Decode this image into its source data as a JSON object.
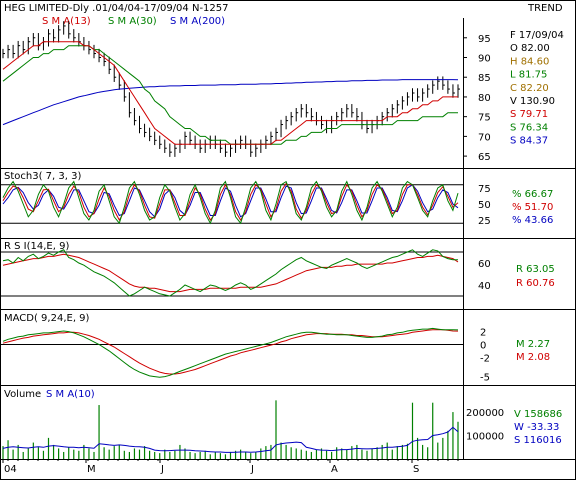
{
  "header": {
    "title": "HEG LIMITED-Dly .01/04/04-17/09/04  N-1257",
    "trend_label": "TREND"
  },
  "colors": {
    "price": "#000000",
    "sma13": "#d00000",
    "sma30": "#008000",
    "sma200": "#0000c0",
    "frame": "#000000"
  },
  "price_panel": {
    "legend": [
      {
        "text": "S M A(13)",
        "color": "#d00000"
      },
      {
        "text": "S M A(30)",
        "color": "#008000"
      },
      {
        "text": "S M A(200)",
        "color": "#0000c0"
      }
    ],
    "y_ticks": [
      "95",
      "90",
      "85",
      "80",
      "75",
      "70",
      "65"
    ],
    "info": [
      {
        "text": "F 17/09/04",
        "color": "#000000"
      },
      {
        "text": "O   82.00",
        "color": "#000000"
      },
      {
        "text": "H   84.60",
        "color": "#a07000"
      },
      {
        "text": "L   81.75",
        "color": "#008000"
      },
      {
        "text": "C   82.20",
        "color": "#a07000"
      },
      {
        "text": "V  130.90",
        "color": "#000000"
      },
      {
        "text": "S   79.71",
        "color": "#d00000"
      },
      {
        "text": "S   76.34",
        "color": "#008000"
      },
      {
        "text": "S   84.37",
        "color": "#0000c0"
      }
    ]
  },
  "stoch_panel": {
    "label": "Stoch3( 7, 3, 3)",
    "y_ticks": [
      "75",
      "50",
      "25"
    ],
    "values": [
      {
        "text": "%   66.67",
        "color": "#008000"
      },
      {
        "text": "%   51.70",
        "color": "#d00000"
      },
      {
        "text": "%   43.66",
        "color": "#0000c0"
      }
    ]
  },
  "rsi_panel": {
    "label": "R S I(14,E, 9)",
    "y_ticks": [
      "60",
      "40"
    ],
    "values": [
      {
        "text": "R   63.05",
        "color": "#008000"
      },
      {
        "text": "R   60.76",
        "color": "#d00000"
      }
    ]
  },
  "macd_panel": {
    "label": "MACD( 9,24,E, 9)",
    "y_ticks": [
      "2",
      "0",
      "-2",
      "-5"
    ],
    "values": [
      {
        "text": "M    2.27",
        "color": "#008000"
      },
      {
        "text": "M    2.08",
        "color": "#d00000"
      }
    ]
  },
  "volume_panel": {
    "label_prefix": "Volume",
    "label_sma": "S M A(10)",
    "y_ticks": [
      "200000",
      "100000"
    ],
    "values": [
      {
        "text": "V  158686",
        "color": "#008000"
      },
      {
        "text": "W   -33.33",
        "color": "#0000c0"
      },
      {
        "text": "S  116016",
        "color": "#0000c0"
      }
    ]
  },
  "x_axis": {
    "ticks": [
      "04",
      "M",
      "J",
      "J",
      "A",
      "S"
    ]
  },
  "chart_data": {
    "type": "line",
    "title": "HEG LIMITED-Dly .01/04/04-17/09/04  N-1257",
    "x_range": [
      "01/04/04",
      "17/09/04"
    ],
    "price": {
      "ylim": [
        63,
        99
      ],
      "close": [
        91,
        92,
        91,
        93,
        92,
        94,
        95,
        93,
        94,
        96,
        95,
        97,
        98,
        96,
        95,
        94,
        93,
        92,
        91,
        90,
        89,
        87,
        85,
        83,
        80,
        76,
        74,
        72,
        71,
        70,
        69,
        68,
        67,
        66,
        67,
        68,
        70,
        69,
        68,
        67,
        68,
        69,
        68,
        67,
        66,
        67,
        68,
        69,
        68,
        66,
        67,
        68,
        69,
        70,
        71,
        73,
        74,
        75,
        76,
        77,
        76,
        75,
        74,
        73,
        72,
        74,
        75,
        76,
        77,
        76,
        75,
        73,
        72,
        73,
        74,
        75,
        76,
        77,
        78,
        79,
        80,
        81,
        80,
        81,
        82,
        83,
        84,
        83,
        82,
        81,
        82
      ],
      "sma13": [
        87,
        88,
        89,
        90,
        91,
        92,
        93,
        93,
        94,
        94,
        94,
        94,
        94,
        94,
        94,
        94,
        93,
        93,
        92,
        91,
        90,
        89,
        88,
        86,
        84,
        82,
        80,
        78,
        76,
        74,
        72,
        71,
        70,
        69,
        68,
        68,
        68,
        68,
        68,
        68,
        68,
        68,
        68,
        68,
        68,
        68,
        68,
        68,
        68,
        68,
        68,
        68,
        68,
        68,
        69,
        69,
        70,
        71,
        72,
        73,
        74,
        74,
        74,
        74,
        74,
        74,
        74,
        74,
        74,
        74,
        74,
        74,
        74,
        74,
        74,
        74,
        75,
        75,
        75,
        76,
        76,
        77,
        77,
        78,
        78,
        79,
        79,
        80,
        80,
        80,
        80
      ],
      "sma30": [
        84,
        85,
        86,
        87,
        88,
        89,
        90,
        90,
        91,
        91,
        92,
        92,
        92,
        93,
        93,
        93,
        93,
        93,
        92,
        92,
        91,
        90,
        89,
        88,
        87,
        86,
        85,
        84,
        82,
        81,
        79,
        78,
        77,
        75,
        74,
        73,
        72,
        72,
        71,
        70,
        70,
        69,
        69,
        69,
        69,
        68,
        68,
        68,
        68,
        68,
        68,
        68,
        68,
        68,
        68,
        68,
        69,
        69,
        69,
        70,
        70,
        71,
        71,
        71,
        72,
        72,
        72,
        73,
        73,
        73,
        73,
        73,
        73,
        73,
        73,
        73,
        73,
        73,
        74,
        74,
        74,
        74,
        74,
        75,
        75,
        75,
        75,
        75,
        76,
        76,
        76
      ],
      "sma200": [
        73,
        73.5,
        74,
        74.5,
        75,
        75.5,
        76,
        76.5,
        77,
        77.5,
        78,
        78.4,
        78.8,
        79.2,
        79.6,
        80,
        80.3,
        80.6,
        80.9,
        81.2,
        81.4,
        81.6,
        81.8,
        82,
        82.1,
        82.2,
        82.3,
        82.4,
        82.5,
        82.6,
        82.6,
        82.7,
        82.7,
        82.8,
        82.8,
        82.8,
        82.9,
        82.9,
        82.9,
        83,
        83,
        83,
        83,
        83.1,
        83.1,
        83.1,
        83.1,
        83.2,
        83.2,
        83.2,
        83.2,
        83.3,
        83.3,
        83.3,
        83.4,
        83.4,
        83.5,
        83.5,
        83.6,
        83.6,
        83.7,
        83.7,
        83.8,
        83.8,
        83.9,
        83.9,
        84,
        84,
        84,
        84.1,
        84.1,
        84.1,
        84.2,
        84.2,
        84.2,
        84.3,
        84.3,
        84.3,
        84.3,
        84.4,
        84.4,
        84.4,
        84.4,
        84.4,
        84.4,
        84.4,
        84.4,
        84.4,
        84.4,
        84.4,
        84.37
      ],
      "last": {
        "open": 82.0,
        "high": 84.6,
        "low": 81.75,
        "close": 82.2
      }
    },
    "stoch": {
      "ylim": [
        0,
        100
      ],
      "levels": [
        80,
        20
      ],
      "k": [
        60,
        75,
        85,
        70,
        50,
        30,
        40,
        65,
        80,
        70,
        45,
        30,
        50,
        75,
        85,
        60,
        35,
        25,
        40,
        70,
        80,
        55,
        30,
        20,
        45,
        75,
        85,
        65,
        40,
        25,
        30,
        60,
        80,
        70,
        45,
        25,
        35,
        65,
        80,
        60,
        35,
        20,
        40,
        75,
        85,
        60,
        30,
        20,
        45,
        75,
        85,
        70,
        40,
        25,
        50,
        80,
        85,
        65,
        35,
        25,
        45,
        75,
        85,
        70,
        45,
        30,
        40,
        70,
        85,
        65,
        40,
        25,
        45,
        75,
        85,
        70,
        50,
        30,
        45,
        75,
        85,
        80,
        60,
        40,
        30,
        55,
        75,
        80,
        55,
        40,
        67
      ],
      "d": [
        55,
        68,
        78,
        75,
        60,
        42,
        38,
        55,
        72,
        73,
        55,
        38,
        45,
        65,
        78,
        68,
        45,
        30,
        35,
        58,
        75,
        62,
        40,
        25,
        38,
        65,
        80,
        70,
        48,
        30,
        28,
        50,
        72,
        72,
        52,
        32,
        32,
        55,
        75,
        65,
        42,
        25,
        35,
        65,
        80,
        65,
        38,
        25,
        38,
        65,
        80,
        73,
        50,
        30,
        42,
        70,
        82,
        70,
        42,
        28,
        40,
        65,
        80,
        73,
        52,
        35,
        38,
        62,
        80,
        70,
        48,
        30,
        40,
        65,
        80,
        73,
        55,
        35,
        40,
        65,
        80,
        80,
        65,
        45,
        33,
        48,
        68,
        77,
        62,
        45,
        52
      ],
      "s": [
        50,
        60,
        72,
        76,
        68,
        52,
        42,
        48,
        65,
        72,
        62,
        45,
        42,
        55,
        72,
        72,
        55,
        38,
        35,
        48,
        68,
        66,
        48,
        32,
        35,
        55,
        75,
        72,
        55,
        38,
        30,
        42,
        65,
        72,
        60,
        40,
        33,
        48,
        68,
        68,
        50,
        32,
        32,
        55,
        75,
        70,
        48,
        30,
        35,
        55,
        75,
        75,
        58,
        38,
        38,
        60,
        78,
        75,
        52,
        35,
        36,
        55,
        75,
        75,
        58,
        40,
        36,
        52,
        72,
        72,
        55,
        36,
        36,
        55,
        75,
        75,
        60,
        40,
        38,
        55,
        75,
        80,
        70,
        52,
        38,
        42,
        60,
        72,
        68,
        50,
        44
      ]
    },
    "rsi": {
      "ylim": [
        20,
        80
      ],
      "levels": [
        70,
        30
      ],
      "rsi": [
        62,
        63,
        60,
        65,
        62,
        66,
        68,
        64,
        66,
        69,
        67,
        70,
        72,
        65,
        63,
        60,
        58,
        55,
        52,
        50,
        48,
        45,
        42,
        38,
        34,
        30,
        32,
        35,
        38,
        36,
        34,
        32,
        31,
        30,
        33,
        36,
        40,
        38,
        36,
        34,
        37,
        40,
        39,
        37,
        35,
        37,
        40,
        42,
        40,
        36,
        38,
        41,
        44,
        47,
        50,
        54,
        57,
        60,
        63,
        65,
        62,
        60,
        58,
        56,
        55,
        58,
        60,
        62,
        64,
        62,
        60,
        57,
        55,
        57,
        59,
        61,
        63,
        65,
        66,
        68,
        70,
        72,
        68,
        66,
        69,
        72,
        71,
        66,
        64,
        63,
        63
      ],
      "signal": [
        58,
        59,
        60,
        61,
        62,
        63,
        64,
        64,
        65,
        66,
        66,
        67,
        68,
        67,
        66,
        65,
        63,
        61,
        59,
        57,
        55,
        53,
        50,
        47,
        44,
        41,
        39,
        38,
        38,
        37,
        37,
        36,
        35,
        34,
        34,
        34,
        35,
        36,
        36,
        36,
        36,
        37,
        37,
        37,
        37,
        37,
        37,
        38,
        38,
        38,
        38,
        38,
        39,
        40,
        41,
        43,
        45,
        47,
        49,
        51,
        53,
        54,
        55,
        56,
        56,
        56,
        57,
        57,
        58,
        58,
        59,
        59,
        59,
        59,
        59,
        59,
        60,
        60,
        61,
        62,
        63,
        64,
        65,
        65,
        66,
        66,
        67,
        66,
        65,
        64,
        61
      ]
    },
    "macd": {
      "ylim": [
        -6,
        3.5
      ],
      "macd": [
        0.5,
        0.8,
        1.0,
        1.2,
        1.3,
        1.5,
        1.6,
        1.7,
        1.8,
        1.8,
        1.9,
        2.0,
        2.1,
        2.0,
        1.8,
        1.5,
        1.2,
        0.8,
        0.4,
        0,
        -0.5,
        -1.0,
        -1.6,
        -2.2,
        -2.8,
        -3.4,
        -3.9,
        -4.3,
        -4.6,
        -4.9,
        -5.0,
        -5.1,
        -5.0,
        -4.8,
        -4.5,
        -4.2,
        -3.9,
        -3.6,
        -3.3,
        -3.0,
        -2.7,
        -2.4,
        -2.1,
        -1.8,
        -1.5,
        -1.3,
        -1.1,
        -0.9,
        -0.7,
        -0.5,
        -0.3,
        -0.1,
        0.1,
        0.3,
        0.6,
        0.9,
        1.2,
        1.4,
        1.6,
        1.8,
        1.9,
        1.9,
        1.8,
        1.7,
        1.6,
        1.6,
        1.5,
        1.5,
        1.5,
        1.4,
        1.3,
        1.2,
        1.1,
        1.1,
        1.2,
        1.3,
        1.5,
        1.6,
        1.8,
        1.9,
        2.1,
        2.2,
        2.3,
        2.4,
        2.4,
        2.5,
        2.4,
        2.3,
        2.3,
        2.3,
        2.27
      ],
      "signal": [
        0.2,
        0.4,
        0.6,
        0.8,
        1.0,
        1.1,
        1.3,
        1.4,
        1.5,
        1.6,
        1.7,
        1.8,
        1.8,
        1.9,
        1.9,
        1.8,
        1.6,
        1.4,
        1.1,
        0.8,
        0.4,
        0,
        -0.4,
        -0.9,
        -1.4,
        -1.9,
        -2.4,
        -2.9,
        -3.3,
        -3.7,
        -4.0,
        -4.3,
        -4.5,
        -4.6,
        -4.6,
        -4.5,
        -4.3,
        -4.1,
        -3.9,
        -3.6,
        -3.3,
        -3.0,
        -2.7,
        -2.4,
        -2.1,
        -1.8,
        -1.6,
        -1.3,
        -1.1,
        -0.9,
        -0.7,
        -0.5,
        -0.3,
        -0.1,
        0.1,
        0.4,
        0.6,
        0.9,
        1.1,
        1.3,
        1.5,
        1.6,
        1.7,
        1.7,
        1.7,
        1.6,
        1.6,
        1.6,
        1.5,
        1.5,
        1.4,
        1.4,
        1.3,
        1.2,
        1.2,
        1.2,
        1.3,
        1.4,
        1.5,
        1.6,
        1.7,
        1.9,
        2.0,
        2.1,
        2.2,
        2.3,
        2.3,
        2.3,
        2.2,
        2.1,
        2.08
      ]
    },
    "volume": {
      "ylim": [
        0,
        260000
      ],
      "bars": [
        55000,
        80000,
        40000,
        60000,
        30000,
        45000,
        70000,
        50000,
        35000,
        90000,
        60000,
        45000,
        30000,
        50000,
        40000,
        35000,
        60000,
        45000,
        30000,
        230000,
        50000,
        40000,
        55000,
        60000,
        35000,
        30000,
        45000,
        40000,
        55000,
        35000,
        30000,
        25000,
        40000,
        30000,
        35000,
        60000,
        45000,
        30000,
        25000,
        30000,
        35000,
        20000,
        30000,
        25000,
        20000,
        30000,
        35000,
        40000,
        30000,
        25000,
        30000,
        45000,
        55000,
        60000,
        250000,
        70000,
        60000,
        50000,
        45000,
        40000,
        35000,
        30000,
        40000,
        45000,
        35000,
        30000,
        50000,
        45000,
        40000,
        55000,
        60000,
        40000,
        35000,
        45000,
        50000,
        60000,
        70000,
        40000,
        55000,
        60000,
        65000,
        240000,
        90000,
        60000,
        50000,
        240000,
        70000,
        90000,
        120000,
        200000,
        158686
      ],
      "sma10": [
        45000,
        50000,
        52000,
        50000,
        48000,
        47000,
        50000,
        52000,
        50000,
        55000,
        57000,
        55000,
        52000,
        50000,
        50000,
        48000,
        50000,
        48000,
        46000,
        65000,
        63000,
        60000,
        58000,
        60000,
        58000,
        55000,
        53000,
        52000,
        50000,
        45000,
        38000,
        36000,
        35000,
        36000,
        37000,
        38000,
        38000,
        37000,
        35000,
        34000,
        33000,
        31000,
        30000,
        30000,
        28000,
        28000,
        29000,
        30000,
        30000,
        29000,
        30000,
        32000,
        35000,
        38000,
        60000,
        65000,
        68000,
        70000,
        72000,
        70000,
        50000,
        45000,
        40000,
        38000,
        37000,
        36000,
        38000,
        40000,
        40000,
        42000,
        45000,
        44000,
        43000,
        44000,
        45000,
        47000,
        50000,
        50000,
        52000,
        54000,
        58000,
        75000,
        80000,
        82000,
        83000,
        100000,
        103000,
        108000,
        115000,
        135000,
        116016
      ]
    }
  }
}
